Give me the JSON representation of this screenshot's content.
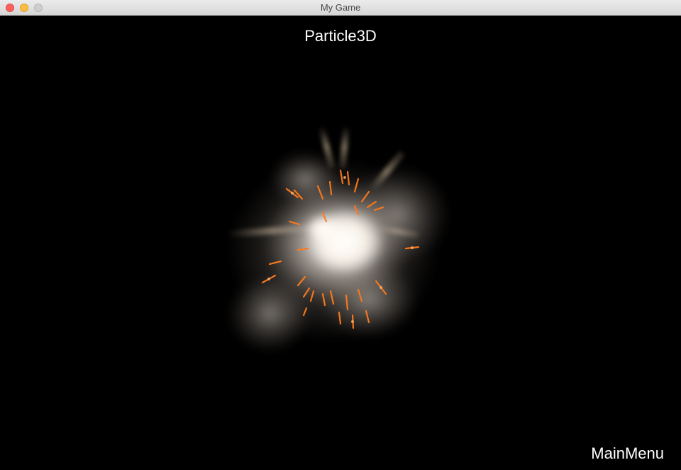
{
  "window": {
    "title": "My Game"
  },
  "scene": {
    "title": "Particle3D",
    "menu_label": "MainMenu"
  },
  "colors": {
    "background": "#000000",
    "text": "#ffffff",
    "spark": "#ff7a1a",
    "smoke": "#d9cfc4"
  },
  "icons": {
    "close": "close-icon",
    "minimize": "minimize-icon",
    "zoom": "zoom-icon"
  }
}
